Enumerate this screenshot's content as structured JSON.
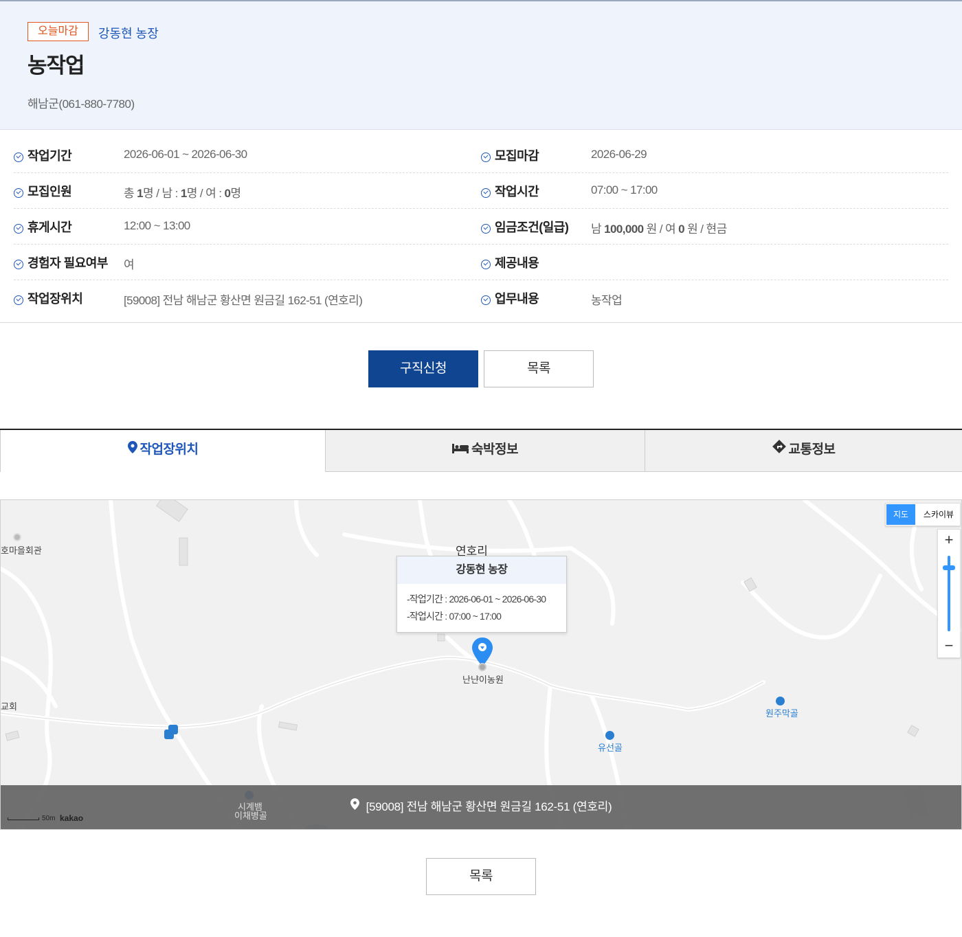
{
  "header": {
    "badge": "오늘마감",
    "farm_name": "강동현 농장",
    "title": "농작업",
    "contact": "해남군(061-880-7780)"
  },
  "info": {
    "work_period_label": "작업기간",
    "work_period_value": "2026-06-01 ~ 2026-06-30",
    "deadline_label": "모집마감",
    "deadline_value": "2026-06-29",
    "recruit_label": "모집인원",
    "recruit_total_prefix": "총",
    "recruit_total": "1",
    "recruit_male_prefix": "명 / 남 :",
    "recruit_male": "1",
    "recruit_female_prefix": "명 / 여 :",
    "recruit_female": "0",
    "recruit_suffix": "명",
    "work_time_label": "작업시간",
    "work_time_value": "07:00 ~ 17:00",
    "break_label": "휴게시간",
    "break_value": "12:00 ~ 13:00",
    "wage_label": "임금조건(일급)",
    "wage_male_prefix": "남",
    "wage_male": "100,000",
    "wage_mid": "원 / 여",
    "wage_female": "0",
    "wage_suffix": "원 / 현금",
    "experience_label": "경험자 필요여부",
    "experience_value": "여",
    "provide_label": "제공내용",
    "provide_value": "",
    "location_label": "작업장위치",
    "location_value": "[59008] 전남 해남군 황산면 원금길 162-51 (연호리)",
    "duty_label": "업무내용",
    "duty_value": "농작업"
  },
  "actions": {
    "apply": "구직신청",
    "list": "목록",
    "list_bottom": "목록"
  },
  "tabs": [
    {
      "label": "작업장위치",
      "icon": "map-pin-icon",
      "active": true
    },
    {
      "label": "숙박정보",
      "icon": "bed-icon",
      "active": false
    },
    {
      "label": "교통정보",
      "icon": "directions-icon",
      "active": false
    }
  ],
  "map": {
    "type_map": "지도",
    "type_sky": "스카이뷰",
    "zoom_in": "+",
    "zoom_out": "−",
    "area_label": "연호리",
    "place_1": "호마을회관",
    "place_2": "교회",
    "place_3": "난냔이농원",
    "place_4": "원주막골",
    "place_5": "유선골",
    "place_6a": "시계뱀",
    "place_6b": "이채병골",
    "popup_title": "강동현 농장",
    "popup_period": "-작업기간 : 2026-06-01 ~ 2026-06-30",
    "popup_time": "-작업시간 : 07:00 ~ 17:00",
    "address": "[59008] 전남 해남군 황산면 원금길 162-51 (연호리)",
    "scale_text": "50m",
    "provider": "kakao"
  },
  "colors": {
    "accent_blue": "#1f57b8",
    "primary_button": "#0f4591",
    "badge_orange": "#e0541e",
    "header_bg": "#eef3fc",
    "map_control_blue": "#3396ff"
  }
}
